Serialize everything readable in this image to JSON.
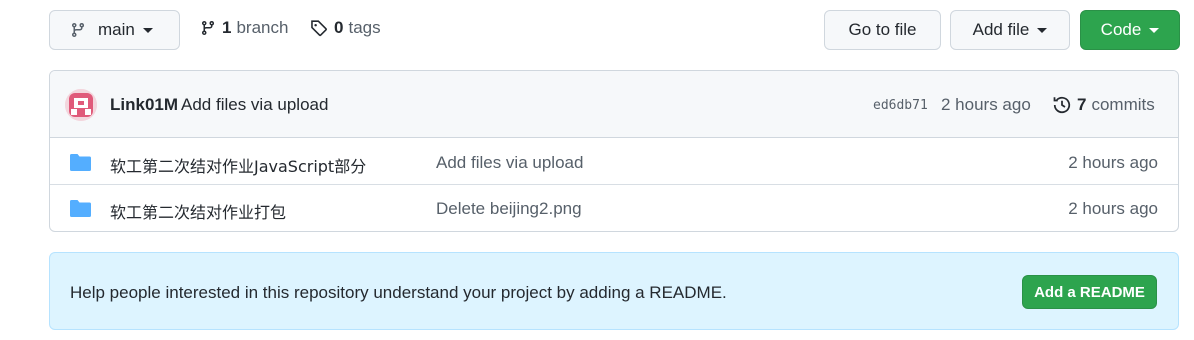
{
  "branch_selector": {
    "label": "main"
  },
  "meta": {
    "branch_count": "1",
    "branch_label": "branch",
    "tag_count": "0",
    "tag_label": "tags"
  },
  "actions": {
    "goto_file": "Go to file",
    "add_file": "Add file",
    "code": "Code"
  },
  "latest_commit": {
    "author": "Link01M",
    "message": "Add files via upload",
    "sha": "ed6db71",
    "time": "2 hours ago",
    "commit_count": "7",
    "commit_label": "commits"
  },
  "files": [
    {
      "name": "软工第二次结对作业JavaScript部分",
      "message": "Add files via upload",
      "age": "2 hours ago",
      "type": "folder"
    },
    {
      "name": "软工第二次结对作业打包",
      "message": "Delete beijing2.png",
      "age": "2 hours ago",
      "type": "folder"
    }
  ],
  "readme": {
    "text": "Help people interested in this repository understand your project by adding a README.",
    "button": "Add a README"
  },
  "colors": {
    "primary_green": "#2da44e",
    "folder_blue": "#54aeff",
    "info_bg": "#ddf4ff"
  },
  "icons": [
    "branch-icon",
    "tag-icon",
    "history-icon",
    "folder-icon",
    "caret-down-icon"
  ]
}
